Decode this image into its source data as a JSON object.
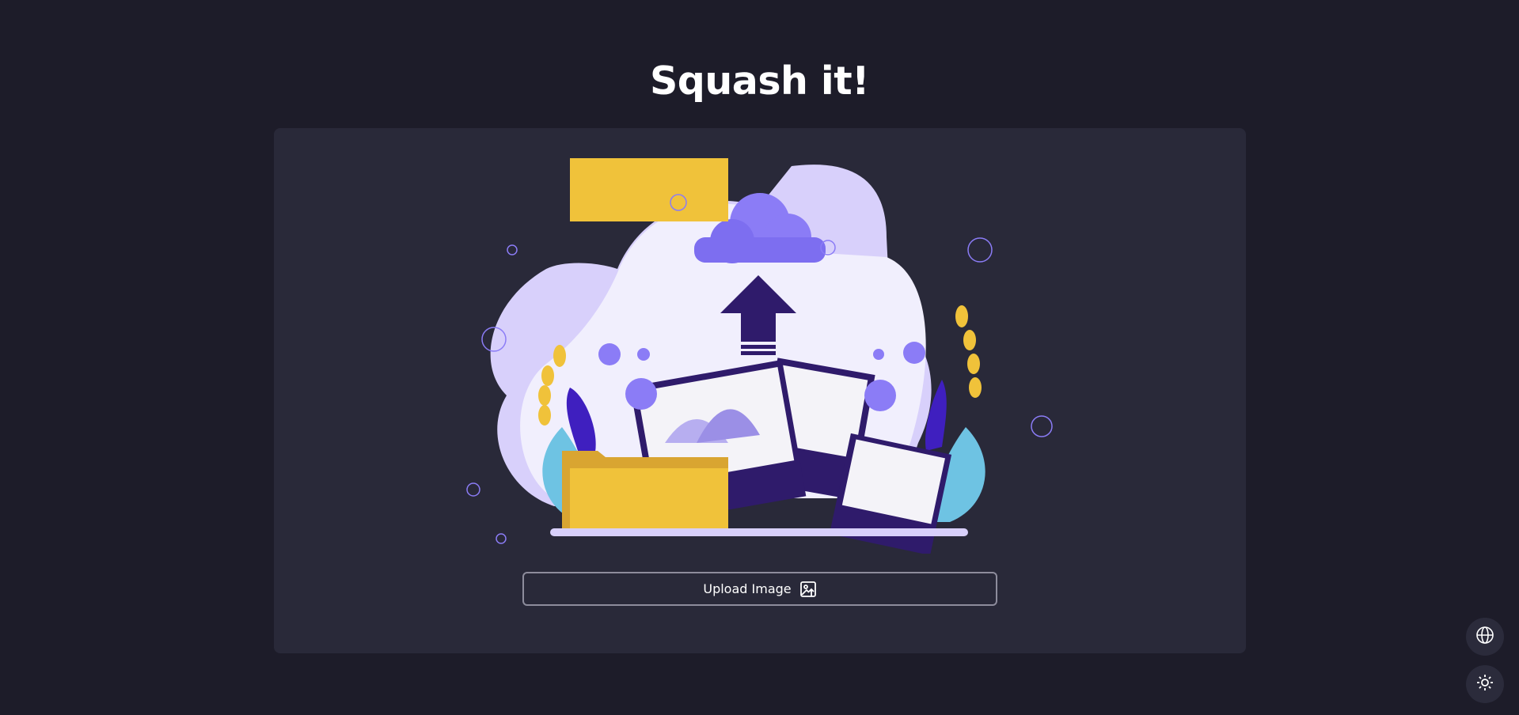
{
  "header": {
    "title": "Squash it!"
  },
  "upload": {
    "button_label": "Upload Image",
    "icon": "image-upload-icon"
  },
  "controls": {
    "language_icon": "globe-icon",
    "theme_icon": "sun-icon"
  },
  "colors": {
    "background": "#1d1c29",
    "card": "#292939",
    "accent_purple": "#8b7cf6",
    "accent_yellow": "#f0c23a",
    "accent_blue": "#6ec3e3",
    "blob_light": "#d8d0fb"
  }
}
